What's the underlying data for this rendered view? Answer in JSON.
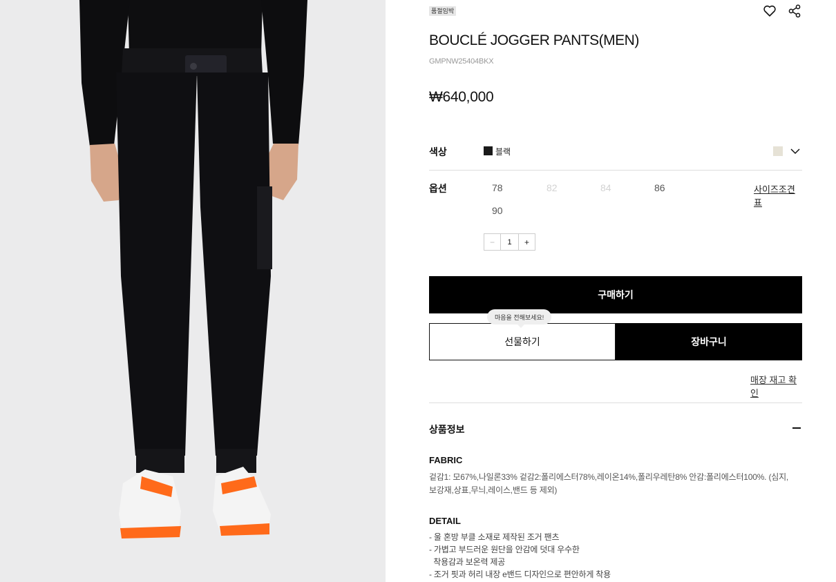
{
  "product": {
    "badge": "품절임박",
    "title": "BOUCLÉ JOGGER PANTS(MEN)",
    "code": "GMPNW25404BKX",
    "price": "₩640,000"
  },
  "color": {
    "label": "색상",
    "selected_name": "블랙",
    "selected_hex": "#1a1a1a",
    "alt_hex": "#e6e2d6"
  },
  "option": {
    "label": "옵션",
    "sizes": [
      {
        "value": "78",
        "available": true
      },
      {
        "value": "82",
        "available": false
      },
      {
        "value": "84",
        "available": false
      },
      {
        "value": "86",
        "available": true
      },
      {
        "value": "90",
        "available": true
      }
    ],
    "size_chart_label": "사이즈조견표",
    "quantity": "1",
    "minus": "−",
    "plus": "+"
  },
  "actions": {
    "buy": "구매하기",
    "gift": "선물하기",
    "gift_tooltip": "마음을 전해보세요!",
    "cart": "장바구니",
    "store_stock": "매장 재고 확인"
  },
  "info": {
    "section_title": "상품정보",
    "fabric_heading": "FABRIC",
    "fabric_line1": "겉감1: 모67%,나일론33% 겉감2:폴리에스터78%,레이온14%,폴리우레탄8% 안감:폴리에스터100%. (심지,",
    "fabric_line2": "보강재,상표,무늬,레이스,밴드 등 제외)",
    "detail_heading": "DETAIL",
    "detail_lines": [
      "- 울 혼방 부클 소재로 제작된 조거 팬츠",
      "- 가볍고 부드러운 원단을 안감에 덧대 우수한",
      "  착용감과 보온력 제공",
      "- 조거 핏과 허리 내장 e밴드 디자인으로 편안하게 착용"
    ]
  },
  "colors": {
    "accent": "#000000",
    "sneaker_orange": "#ff6a1a",
    "photo_bg": "#e9e9ea"
  }
}
